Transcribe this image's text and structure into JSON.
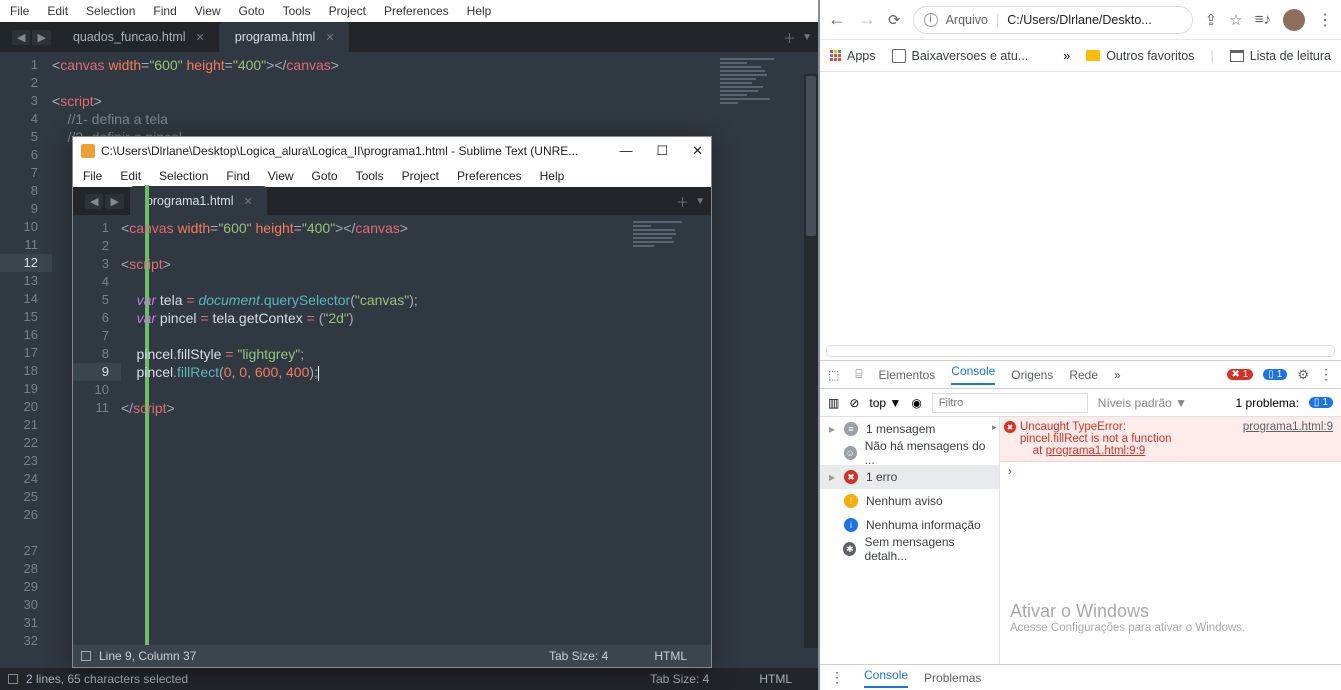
{
  "back": {
    "menu": [
      "File",
      "Edit",
      "Selection",
      "Find",
      "View",
      "Goto",
      "Tools",
      "Project",
      "Preferences",
      "Help"
    ],
    "tabs": [
      {
        "label": "quados_funcao.html",
        "active": false
      },
      {
        "label": "programa.html",
        "active": true
      }
    ],
    "status_left": "2 lines, 65 characters selected",
    "status_tab": "Tab Size: 4",
    "status_lang": "HTML"
  },
  "front": {
    "title": "C:\\Users\\Dlrlane\\Desktop\\Logica_alura\\Logica_II\\programa1.html - Sublime Text (UNRE...",
    "menu": [
      "File",
      "Edit",
      "Selection",
      "Find",
      "View",
      "Goto",
      "Tools",
      "Project",
      "Preferences",
      "Help"
    ],
    "tab": "programa1.html",
    "status_left": "Line 9, Column 37",
    "status_tab": "Tab Size: 4",
    "status_lang": "HTML"
  },
  "chrome": {
    "url_label": "Arquivo",
    "url_path": "C:/Users/Dlrlane/Deskto...",
    "bookmarks": {
      "apps": "Apps",
      "baixar": "Baixaversoes e atu...",
      "outros": "Outros favoritos",
      "leitura": "Lista de leitura"
    },
    "devtools": {
      "tabs": [
        "Elementos",
        "Console",
        "Origens",
        "Rede"
      ],
      "error_badge": "1",
      "msg_badge": "1",
      "context": "top",
      "filter_ph": "Filtro",
      "levels": "Níveis padrão",
      "problem": "1 problema:",
      "prob_badge": "1",
      "sidebar": [
        {
          "k": "msg",
          "label": "1 mensagem"
        },
        {
          "k": "usr",
          "label": "Não há mensagens do ..."
        },
        {
          "k": "err",
          "label": "1 erro"
        },
        {
          "k": "wrn",
          "label": "Nenhum aviso"
        },
        {
          "k": "inf",
          "label": "Nenhuma informação"
        },
        {
          "k": "bug",
          "label": "Sem mensagens detalh..."
        }
      ],
      "error": {
        "head": "Uncaught TypeError:",
        "src": "programa1.html:9",
        "body": "pincel.fillRect is not a function",
        "at": "at ",
        "at_link": "programa1.html:9:9"
      },
      "footer": [
        "Console",
        "Problemas"
      ]
    },
    "watermark": {
      "t": "Ativar o Windows",
      "s": "Acesse Configurações para ativar o Windows."
    }
  }
}
